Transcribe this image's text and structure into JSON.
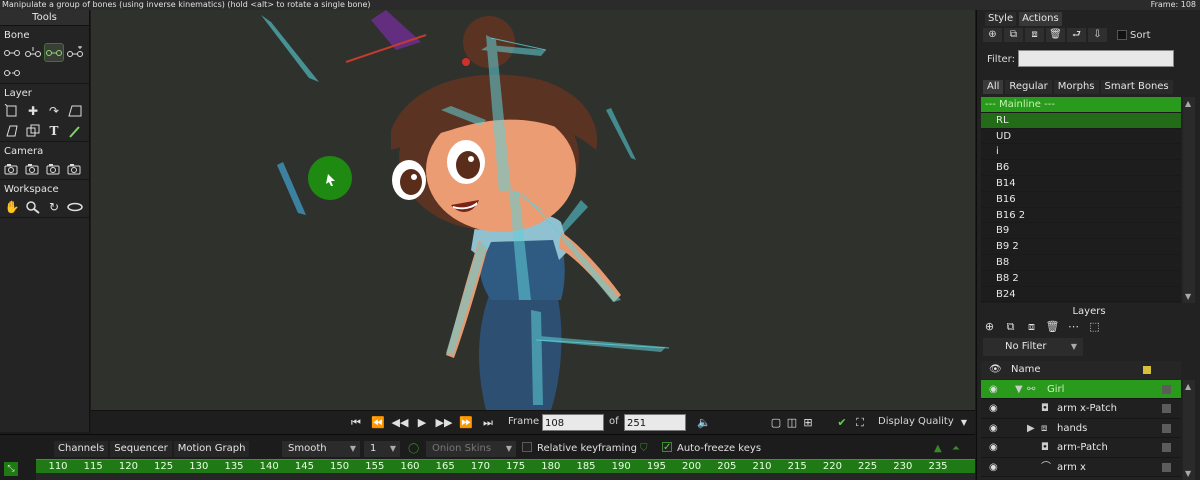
{
  "status": {
    "hint": "Manipulate a group of bones (using inverse kinematics) (hold <alt> to rotate a single bone)",
    "frame_readout": "Frame: 108"
  },
  "tools_panel": {
    "title": "Tools",
    "sections": [
      {
        "label": "Bone",
        "tools": [
          "bone-select-icon",
          "bone-translate-icon",
          "bone-manipulate-icon",
          "bone-add-icon",
          "bone-reparent-icon"
        ]
      },
      {
        "label": "Layer",
        "tools": [
          "layer-transform-icon",
          "set-origin-icon",
          "rotate-layer-icon",
          "shear-layer-icon",
          "layer-flip-icon",
          "switch-layer-icon",
          "text-icon",
          "eyedropper-icon"
        ]
      },
      {
        "label": "Camera",
        "tools": [
          "camera-track-icon",
          "camera-zoom-icon",
          "camera-roll-icon",
          "camera-pan-icon"
        ]
      },
      {
        "label": "Workspace",
        "tools": [
          "hand-pan-icon",
          "magnify-icon",
          "rotate-workspace-icon",
          "orbit-icon"
        ]
      }
    ]
  },
  "playback": {
    "frame_label": "Frame",
    "frame_value": "108",
    "of_label": "of",
    "end_value": "251",
    "display_quality": "Display Quality"
  },
  "timeline": {
    "tabs": [
      "Channels",
      "Sequencer",
      "Motion Graph"
    ],
    "interpolation": "Smooth",
    "keyframe_step": "1",
    "onion_skins": "Onion Skins",
    "relative_keyframing": "Relative keyframing",
    "auto_freeze": "Auto-freeze keys",
    "ruler_ticks": [
      "110",
      "115",
      "120",
      "125",
      "130",
      "135",
      "140",
      "145",
      "150",
      "155",
      "160",
      "165",
      "170",
      "175",
      "180",
      "185",
      "190",
      "195",
      "200",
      "205",
      "210",
      "215",
      "220",
      "225",
      "230",
      "235"
    ]
  },
  "right_panel": {
    "tabs": [
      "Style",
      "Actions"
    ],
    "sort_label": "Sort",
    "filter_label": "Filter:",
    "filter_value": "",
    "action_tabs": [
      "All",
      "Regular",
      "Morphs",
      "Smart Bones"
    ],
    "actions": [
      "--- Mainline ---",
      "RL",
      "UD",
      "i",
      "B6",
      "B14",
      "B16",
      "B16 2",
      "B9",
      "B9 2",
      "B8",
      "B8 2",
      "B24"
    ],
    "layers_title": "Layers",
    "layer_filter": "No Filter",
    "layer_header": "Name",
    "layers": [
      {
        "name": "Girl",
        "type": "bone-layer-icon",
        "indent": 1,
        "expanded": true,
        "selected": true
      },
      {
        "name": "arm x-Patch",
        "type": "patch-layer-icon",
        "indent": 2,
        "expanded": false,
        "selected": false
      },
      {
        "name": "hands",
        "type": "switch-layer-icon",
        "indent": 2,
        "expanded": false,
        "selected": false,
        "collapsible": true
      },
      {
        "name": "arm-Patch",
        "type": "patch-layer-icon",
        "indent": 2,
        "expanded": false,
        "selected": false
      },
      {
        "name": "arm x",
        "type": "vector-layer-icon",
        "indent": 2,
        "expanded": false,
        "selected": false
      }
    ]
  },
  "colors": {
    "accent_green": "#2a9a1c",
    "canvas_bg": "#2f312d",
    "bone_cyan": "#5fd0d8",
    "bone_selected_red": "#c23b2e"
  }
}
